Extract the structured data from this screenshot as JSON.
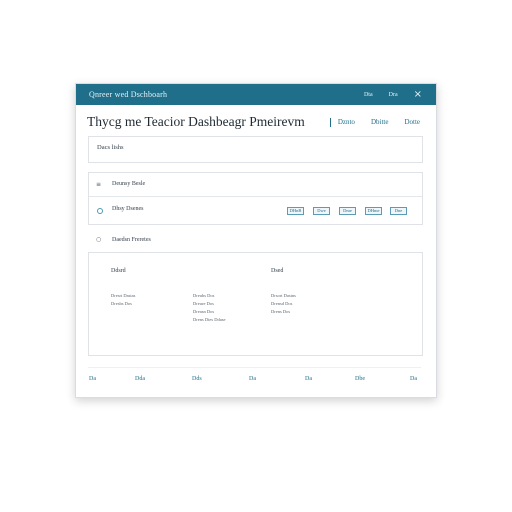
{
  "window": {
    "title": "Qnreer wed Dschboarh",
    "buttons": [
      "Dta",
      "Dra"
    ],
    "close": "×"
  },
  "header": {
    "title": "Thycg me Teacior Dashbeagr Pmeirevm",
    "links": [
      "Dznto",
      "Dbitte",
      "Dotte"
    ]
  },
  "panel_a": {
    "label": "Dacs lishs"
  },
  "panel_b": {
    "row1": {
      "icon": "≡",
      "label": "Deunsy Besle"
    },
    "row2": {
      "label": "Dhsy Dsenes"
    },
    "chips": [
      "DHnB",
      "Dwe",
      "Dme",
      "DHme",
      "Dne"
    ]
  },
  "panel_c": {
    "section_icon": "○",
    "section_label": "Daedsn Freretes",
    "col1": {
      "title": "Ddsrd",
      "lines": "Dresrt Dastas\nDresbs Dos"
    },
    "col2": {
      "lines": "Dreubs Dos\nDreure Dos\nDreasn Dos\nDrens Dtes Ddase"
    },
    "col3": {
      "title": "Dsed",
      "lines": "Drsort Dastns\nDrensd Dos\nDrens Dos"
    }
  },
  "footer": {
    "links": [
      "Da",
      "Dda",
      "Dds",
      "Da",
      "Da",
      "Dbe",
      "Da"
    ]
  },
  "colors": {
    "titlebar": "#1f6f8b",
    "accent": "#1f6f8b",
    "chip_border": "#5a9bb5"
  }
}
